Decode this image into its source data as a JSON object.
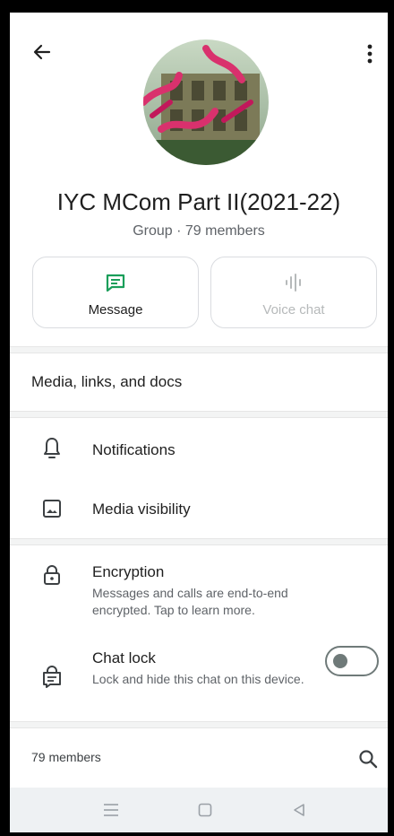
{
  "header": {
    "back_icon": "arrow-left-icon",
    "more_icon": "more-vert-icon"
  },
  "group": {
    "name": "IYC MCom Part II(2021-22)",
    "subtitle": "Group · 79 members"
  },
  "actions": [
    {
      "label": "Message",
      "icon": "message-icon",
      "color": "#1a9e5a",
      "enabled": true
    },
    {
      "label": "Voice chat",
      "icon": "waveform-icon",
      "color": "#b6b9ba",
      "enabled": false
    }
  ],
  "media_section": {
    "label": "Media, links, and docs"
  },
  "settings": {
    "notifications": {
      "title": "Notifications",
      "icon": "bell-icon"
    },
    "media_visibility": {
      "title": "Media visibility",
      "icon": "image-icon"
    },
    "encryption": {
      "title": "Encryption",
      "description": "Messages and calls are end-to-end encrypted. Tap to learn more.",
      "icon": "lock-icon"
    },
    "chat_lock": {
      "title": "Chat lock",
      "description": "Lock and hide this chat on this device.",
      "icon": "chat-lock-icon",
      "enabled": false
    }
  },
  "members": {
    "label": "79 members",
    "search_icon": "search-icon"
  },
  "navbar": {
    "menu_icon": "menu-icon",
    "home_icon": "home-square-icon",
    "back_icon": "triangle-back-icon"
  },
  "colors": {
    "accent_green": "#1a9e5a",
    "divider": "#f3f4f4",
    "navbar_bg": "#eef1f3"
  }
}
